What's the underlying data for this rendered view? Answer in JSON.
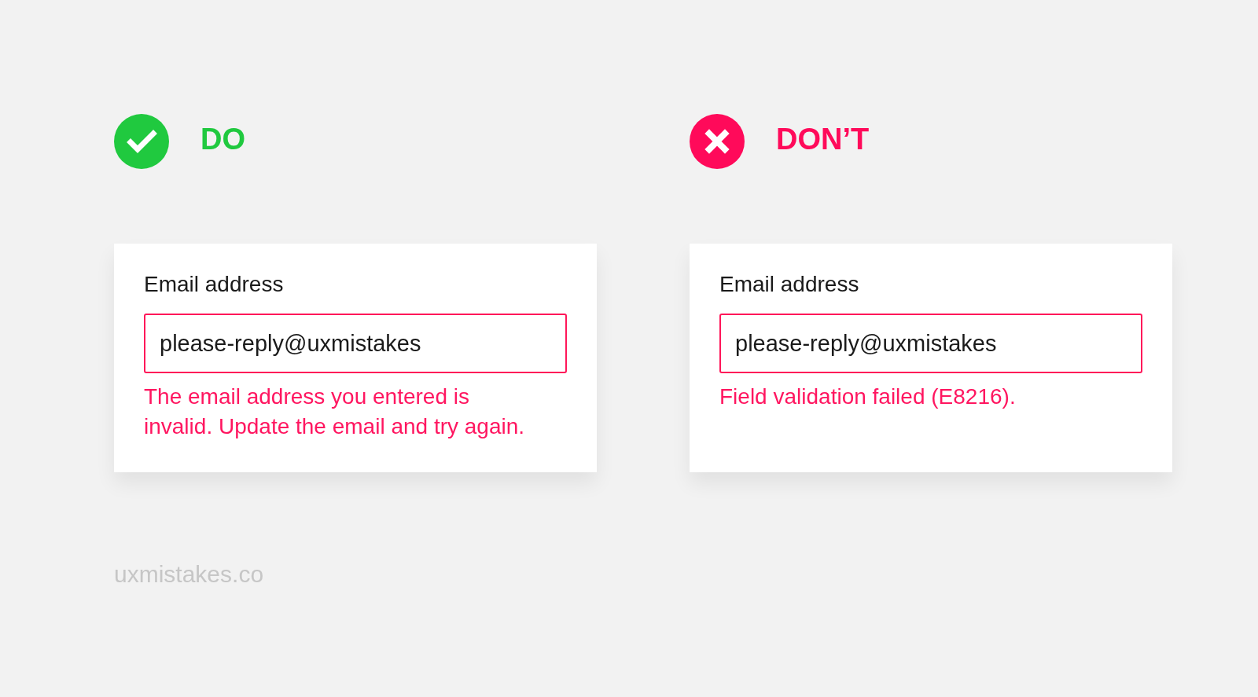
{
  "panels": [
    {
      "kind": "do",
      "verdict": "DO",
      "field": {
        "label": "Email address",
        "value": "please-reply@uxmistakes",
        "invalid": true
      },
      "error": "The email address you entered is invalid. Update the email and try again."
    },
    {
      "kind": "dont",
      "verdict": "DON’T",
      "field": {
        "label": "Email address",
        "value": "please-reply@uxmistakes",
        "invalid": true
      },
      "error": "Field validation failed (E8216)."
    }
  ],
  "credit": "uxmistakes.co"
}
